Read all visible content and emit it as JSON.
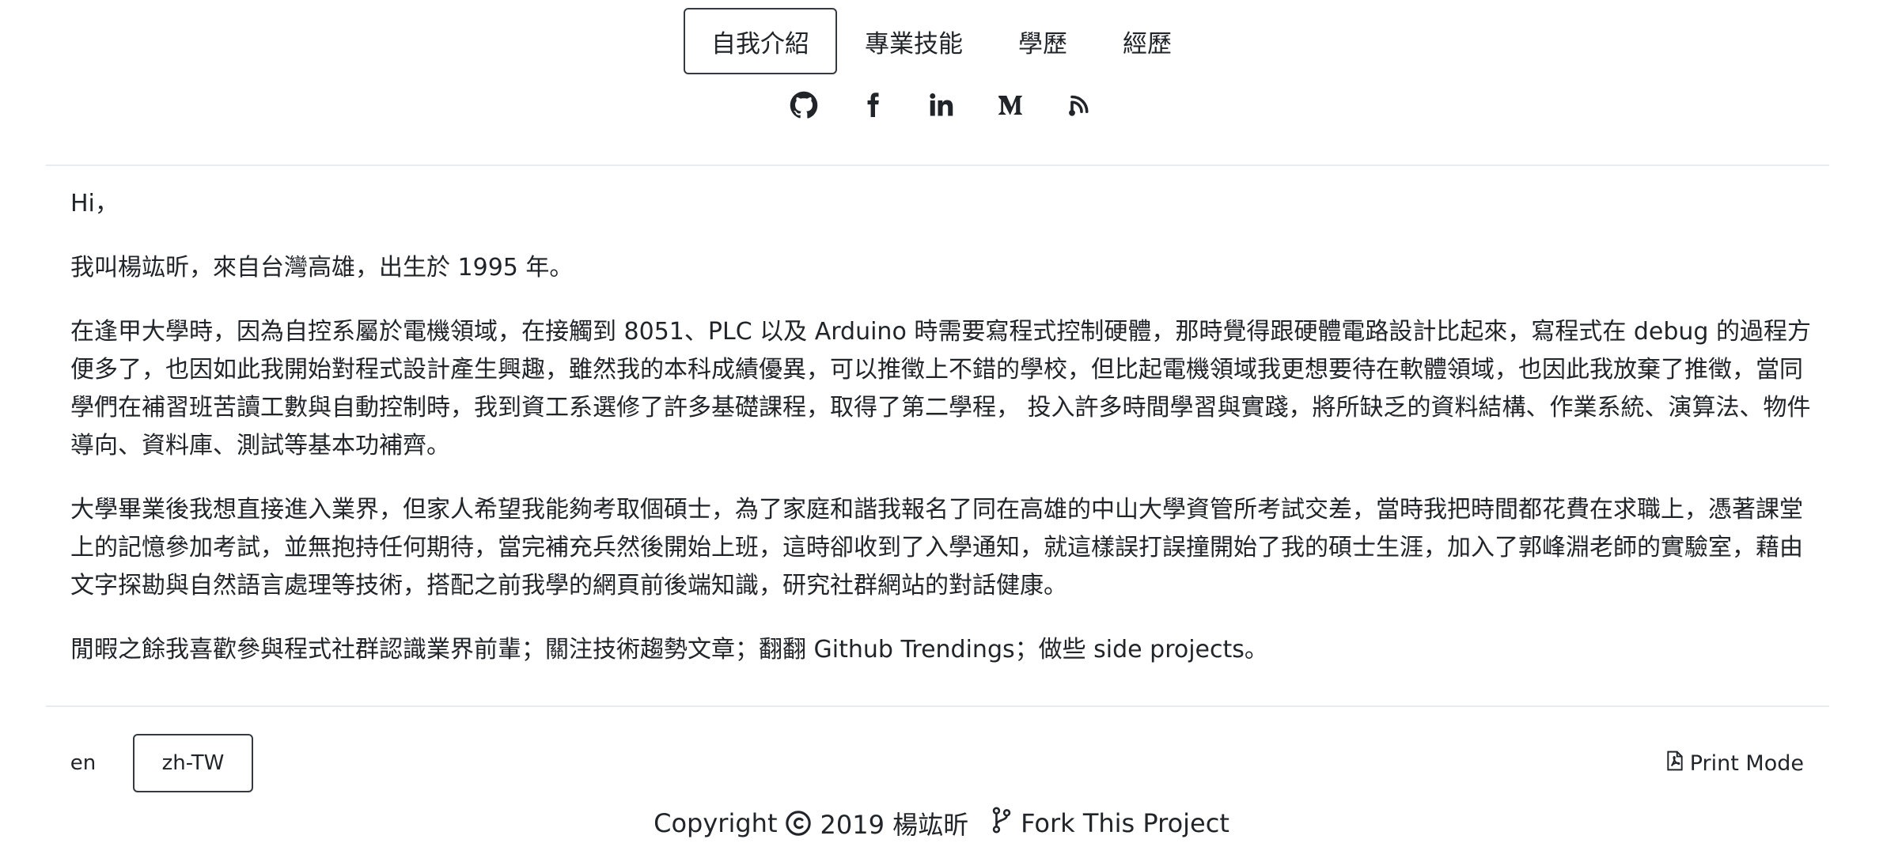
{
  "nav": {
    "tabs": [
      {
        "label": "自我介紹",
        "active": true
      },
      {
        "label": "專業技能",
        "active": false
      },
      {
        "label": "學歷",
        "active": false
      },
      {
        "label": "經歷",
        "active": false
      }
    ]
  },
  "socials": [
    {
      "icon": "github-icon"
    },
    {
      "icon": "facebook-icon"
    },
    {
      "icon": "linkedin-icon"
    },
    {
      "icon": "medium-icon"
    },
    {
      "icon": "blog-icon"
    }
  ],
  "about": {
    "greeting": "Hi，",
    "paragraphs": [
      "我叫楊竑昕，來自台灣高雄，出生於 1995 年。",
      "在逢甲大學時，因為自控系屬於電機領域，在接觸到 8051、PLC 以及 Arduino 時需要寫程式控制硬體，那時覺得跟硬體電路設計比起來，寫程式在 debug 的過程方便多了，也因如此我開始對程式設計產生興趣，雖然我的本科成績優異，可以推徵上不錯的學校，但比起電機領域我更想要待在軟體領域，也因此我放棄了推徵，當同學們在補習班苦讀工數與自動控制時，我到資工系選修了許多基礎課程，取得了第二學程， 投入許多時間學習與實踐，將所缺乏的資料結構、作業系統、演算法、物件導向、資料庫、測試等基本功補齊。",
      "大學畢業後我想直接進入業界，但家人希望我能夠考取個碩士，為了家庭和諧我報名了同在高雄的中山大學資管所考試交差，當時我把時間都花費在求職上，憑著課堂上的記憶參加考試，並無抱持任何期待，當完補充兵然後開始上班，這時卻收到了入學通知，就這樣誤打誤撞開始了我的碩士生涯，加入了郭峰淵老師的實驗室，藉由文字探勘與自然語言處理等技術，搭配之前我學的網頁前後端知識，研究社群網站的對話健康。",
      "閒暇之餘我喜歡參與程式社群認識業界前輩；關注技術趨勢文章；翻翻 Github Trendings；做些 side projects。"
    ]
  },
  "footer": {
    "languages": [
      {
        "label": "en",
        "active": false
      },
      {
        "label": "zh-TW",
        "active": true
      }
    ],
    "print_label": "Print Mode",
    "copyright_prefix": "Copyright",
    "copyright_suffix": "2019 楊竑昕",
    "fork_label": "Fork This Project"
  }
}
